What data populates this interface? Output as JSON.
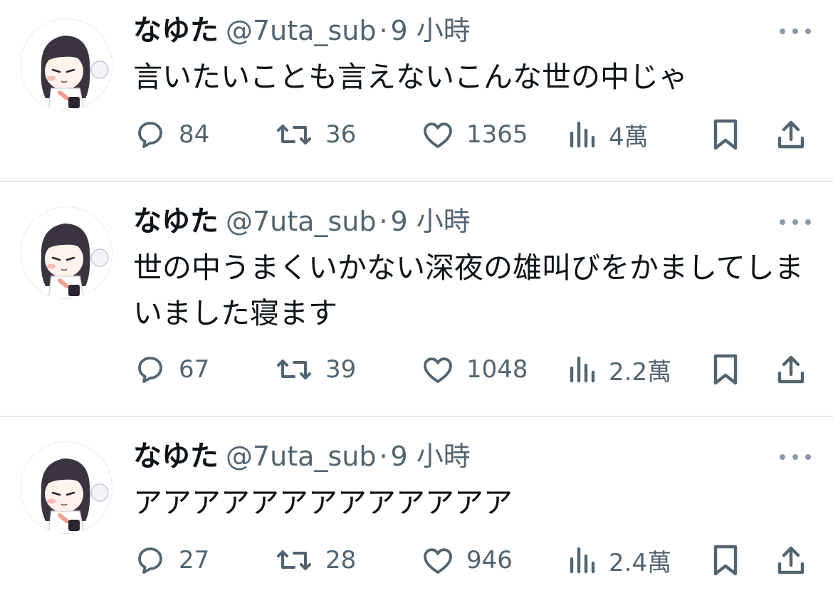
{
  "tweets": [
    {
      "name": "なゆた",
      "handle": "@7uta_sub",
      "separator": "·",
      "time": "9 小時",
      "text": "言いたいことも言えないこんな世の中じゃ",
      "replies": "84",
      "retweets": "36",
      "likes": "1365",
      "views": "4萬"
    },
    {
      "name": "なゆた",
      "handle": "@7uta_sub",
      "separator": "·",
      "time": "9 小時",
      "text": "世の中うまくいかない深夜の雄叫びをかましてしまいました寝ます",
      "replies": "67",
      "retweets": "39",
      "likes": "1048",
      "views": "2.2萬"
    },
    {
      "name": "なゆた",
      "handle": "@7uta_sub",
      "separator": "·",
      "time": "9 小時",
      "text": "アアアアアアアアアアアアア",
      "replies": "27",
      "retweets": "28",
      "likes": "946",
      "views": "2.4萬"
    }
  ],
  "icons": [
    "reply-icon",
    "retweet-icon",
    "like-icon",
    "views-icon",
    "bookmark-icon",
    "share-icon",
    "more-icon"
  ],
  "colors": {
    "text": "#0f1419",
    "secondary": "#536471",
    "divider": "#e4e8eb",
    "icon": "#536471"
  }
}
